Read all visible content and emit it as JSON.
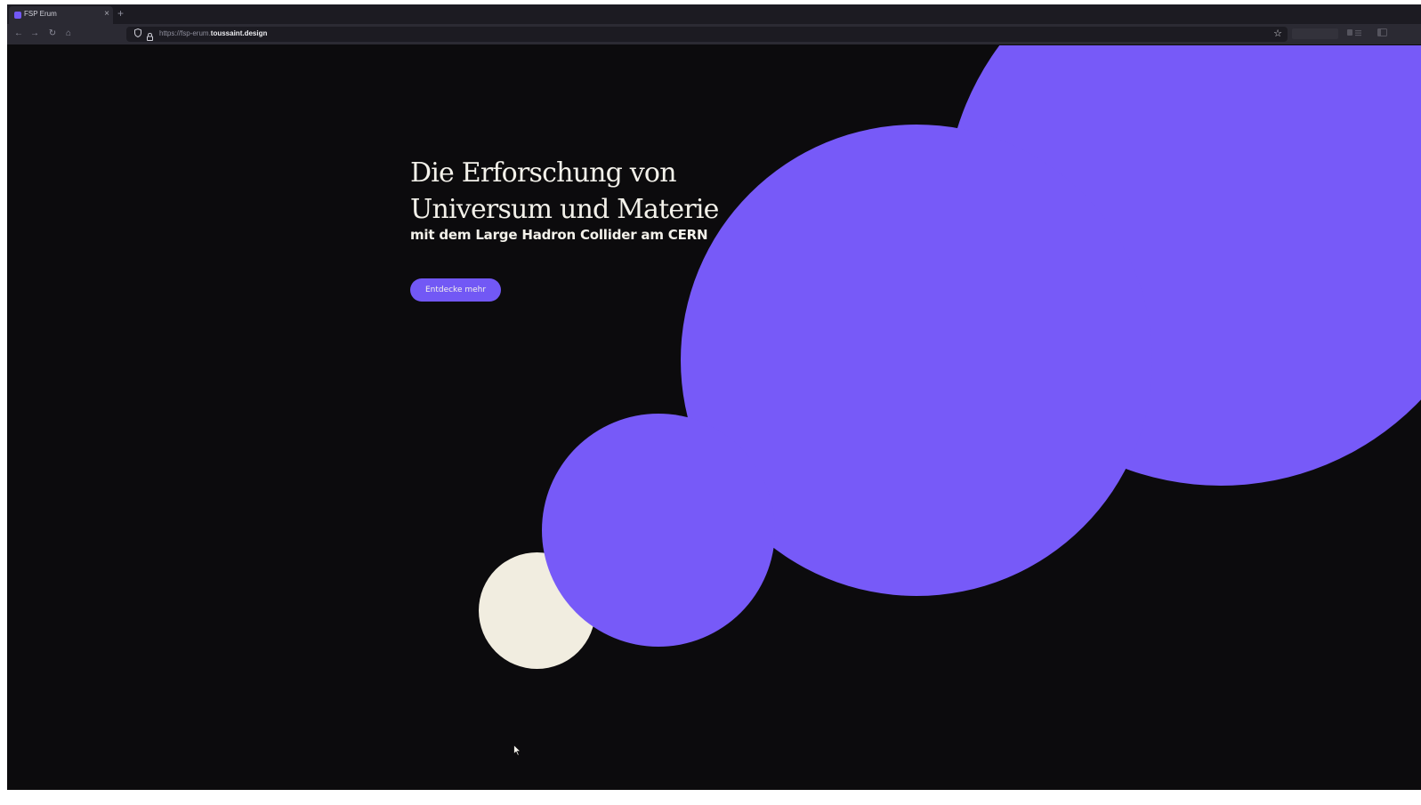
{
  "browser": {
    "tab": {
      "title": "FSP Erum",
      "close_glyph": "×"
    },
    "new_tab_glyph": "+",
    "nav": {
      "back_glyph": "←",
      "forward_glyph": "→",
      "reload_glyph": "↻",
      "home_glyph": "⌂"
    },
    "url": {
      "prefix": "https://fsp-erum.",
      "domain": "toussaint.design"
    },
    "bookmark_glyph": "☆",
    "icons": [
      "shield-icon",
      "lock-icon",
      "star-icon",
      "extension-icon",
      "menu-icon"
    ]
  },
  "hero": {
    "title_line1": "Die Erforschung von",
    "title_line2": "Universum und Materie",
    "subtitle": "mit dem Large Hadron Collider am CERN",
    "cta_label": "Entdecke mehr"
  },
  "colors": {
    "background": "#0c0b0d",
    "accent_purple": "#775af8",
    "button_purple": "#7258f5",
    "cream": "#f1ede0",
    "text_light": "#f3f1ea"
  }
}
